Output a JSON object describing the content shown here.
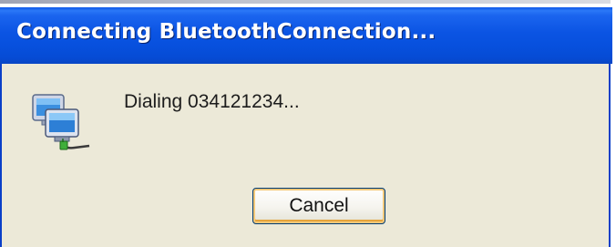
{
  "window": {
    "title": "Connecting BluetoothConnection..."
  },
  "body": {
    "icon": "network-connection-icon",
    "message": "Dialing 034121234..."
  },
  "buttons": {
    "cancel_label": "Cancel"
  },
  "colors": {
    "titlebar_blue": "#0a56e4",
    "dialog_face": "#ece9d8",
    "button_focus_orange": "#e6a43b"
  }
}
